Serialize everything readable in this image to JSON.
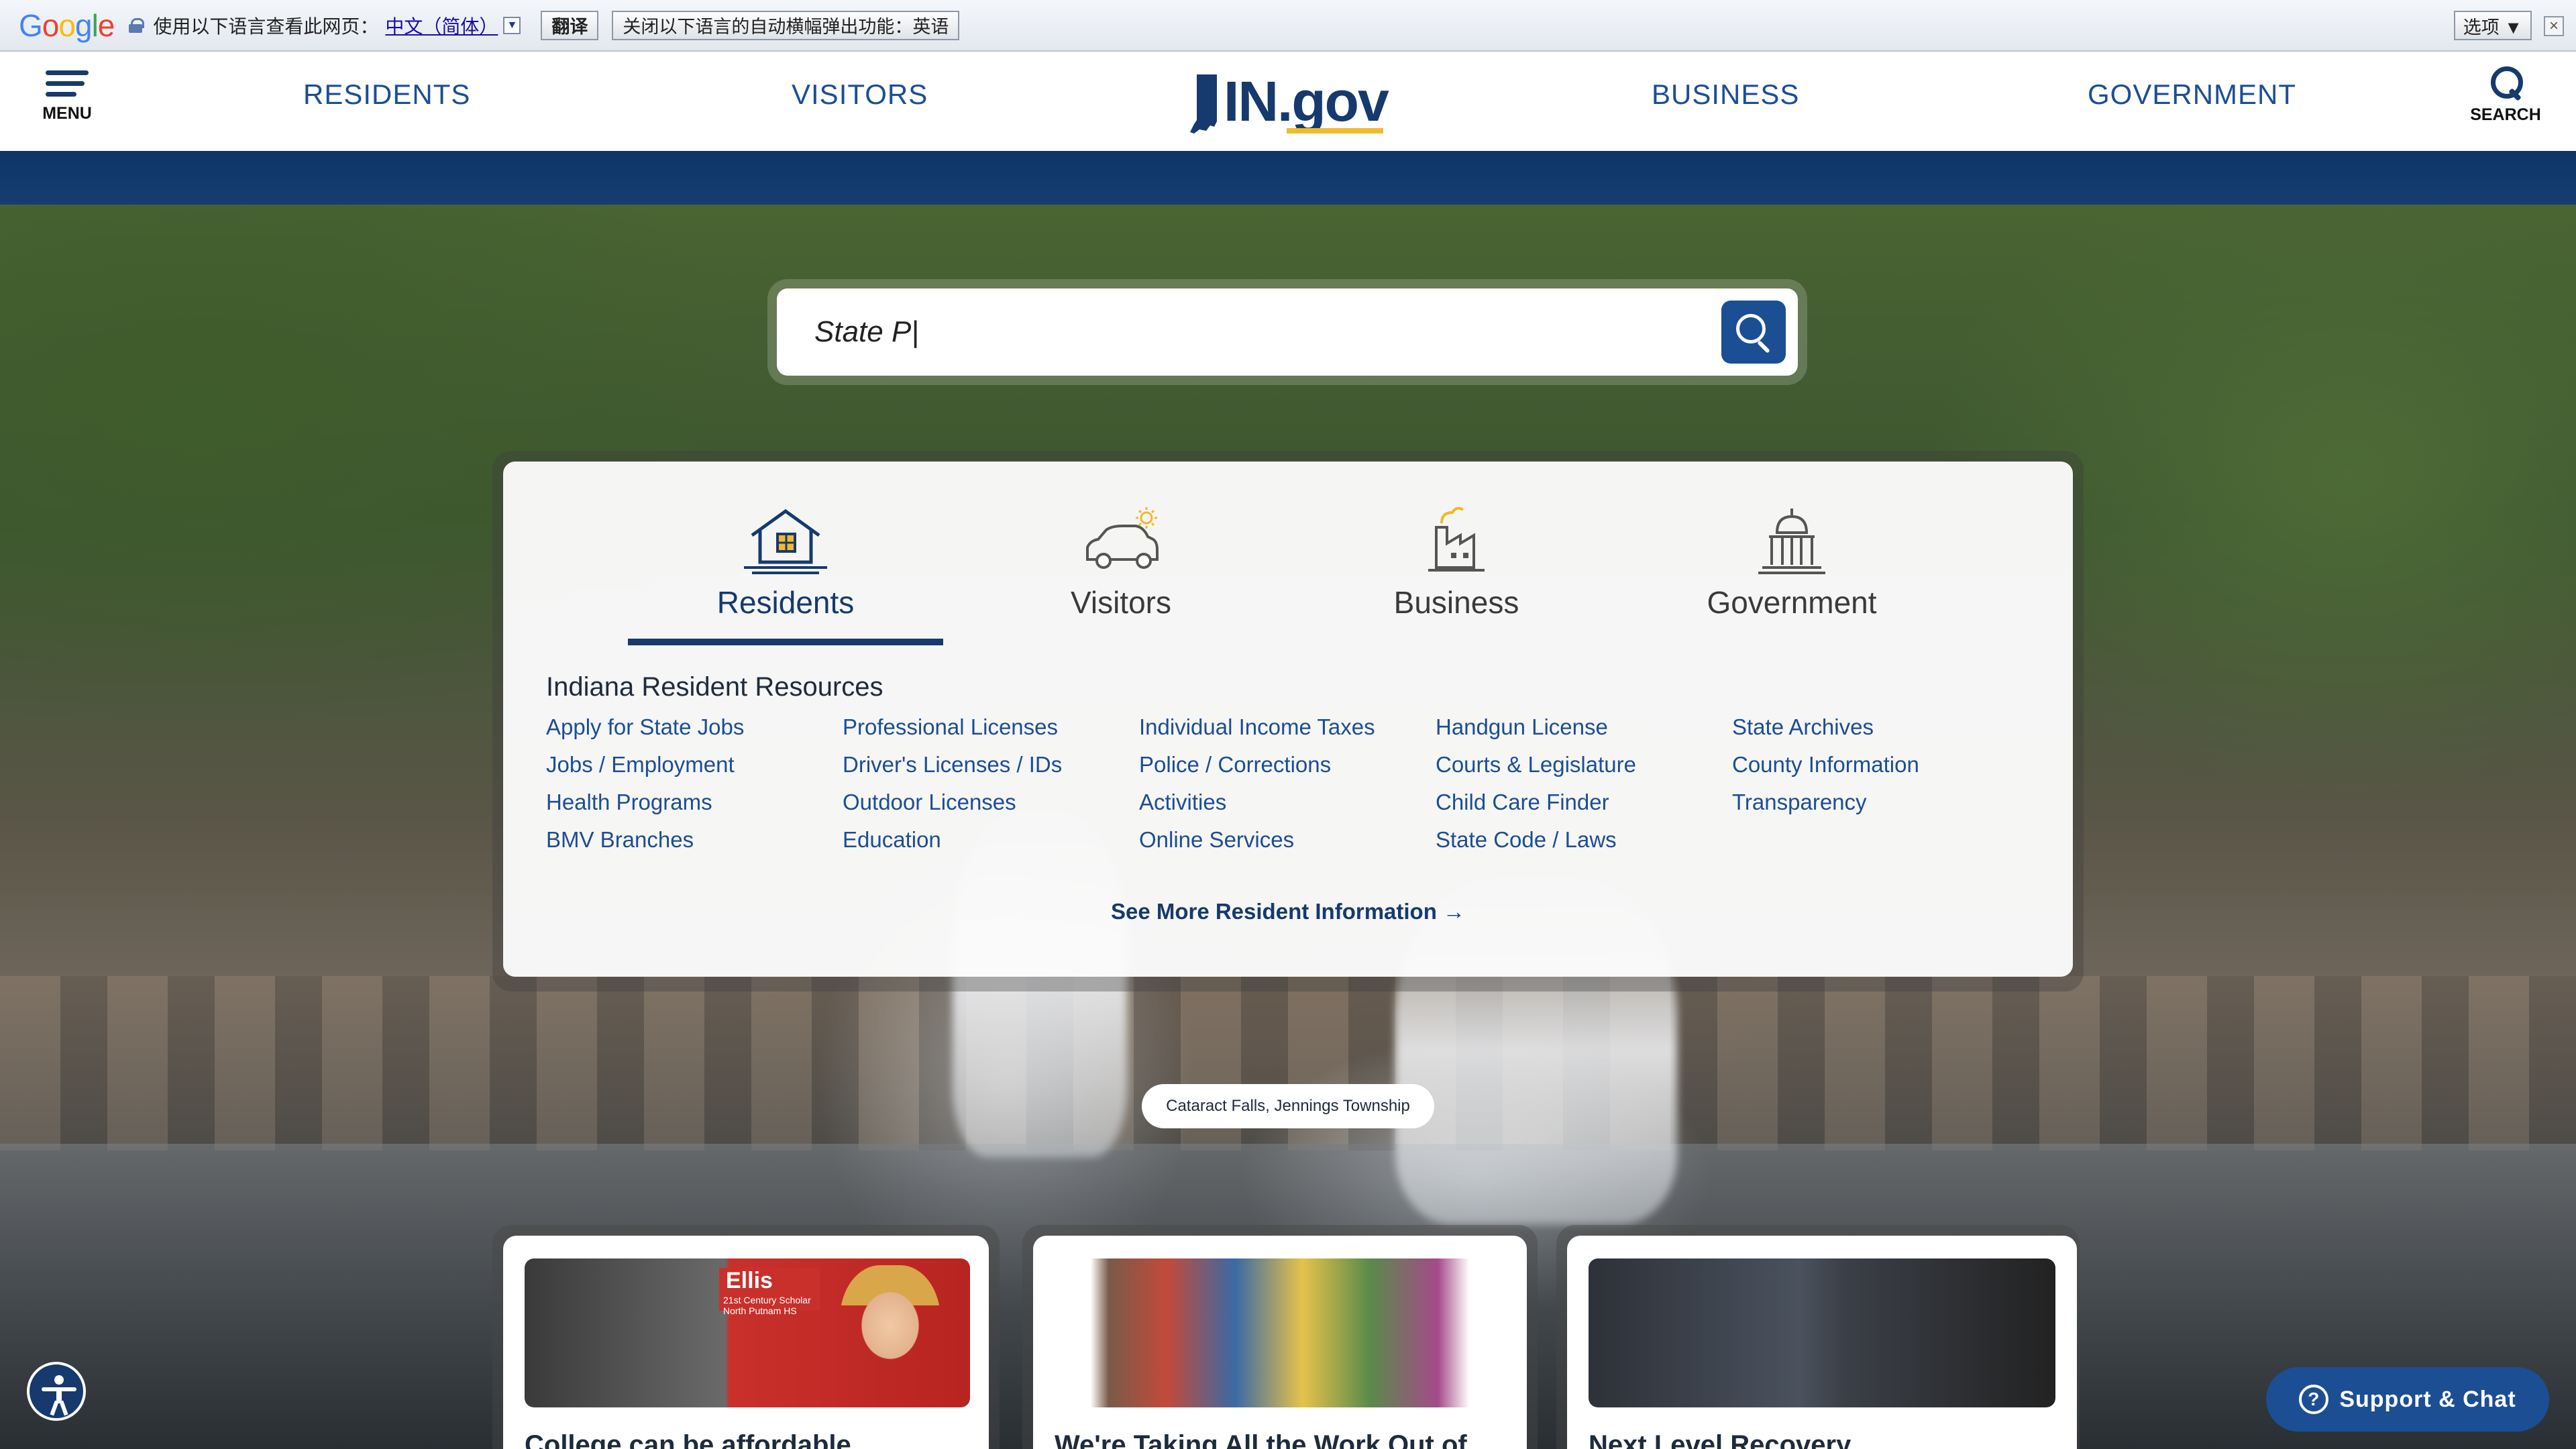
{
  "translate_bar": {
    "logo": "Google",
    "prompt": "使用以下语言查看此网页：",
    "language": "中文（简体）",
    "dropdown_glyph": "▼",
    "translate_button": "翻译",
    "never_button": "关闭以下语言的自动横幅弹出功能：英语",
    "options_button": "选项 ▼",
    "close_glyph": "×"
  },
  "header": {
    "menu_label": "MENU",
    "search_label": "SEARCH",
    "nav": [
      "RESIDENTS",
      "VISITORS",
      "BUSINESS",
      "GOVERNMENT"
    ],
    "logo_text": "IN.gov"
  },
  "search": {
    "value": "State P|",
    "placeholder": ""
  },
  "tabs": [
    {
      "label": "Residents",
      "icon": "house-icon",
      "active": true
    },
    {
      "label": "Visitors",
      "icon": "car-icon",
      "active": false
    },
    {
      "label": "Business",
      "icon": "factory-icon",
      "active": false
    },
    {
      "label": "Government",
      "icon": "capitol-icon",
      "active": false
    }
  ],
  "resources": {
    "title": "Indiana Resident Resources",
    "columns": [
      [
        "Apply for State Jobs",
        "Jobs / Employment",
        "Health Programs",
        "BMV Branches"
      ],
      [
        "Professional Licenses",
        "Driver's Licenses / IDs",
        "Outdoor Licenses",
        "Education"
      ],
      [
        "Individual Income Taxes",
        "Police / Corrections",
        "Activities",
        "Online Services"
      ],
      [
        "Handgun License",
        "Courts & Legislature",
        "Child Care Finder",
        "State Code / Laws"
      ],
      [
        "State Archives",
        "County Information",
        "Transparency"
      ]
    ],
    "see_more": "See More Resident Information →"
  },
  "caption": "Cataract Falls, Jennings Township",
  "cards": [
    {
      "title": "College can be affordable",
      "banner": "Ellis",
      "banner_sub": "21st Century Scholar North Putnam HS"
    },
    {
      "title": "We're Taking All the Work Out of"
    },
    {
      "title": "Next Level Recovery"
    }
  ],
  "support": {
    "label": "Support & Chat",
    "icon_glyph": "?"
  },
  "colors": {
    "brand_blue": "#1c4e93",
    "navy": "#163a6e",
    "gold": "#f2b92b"
  }
}
